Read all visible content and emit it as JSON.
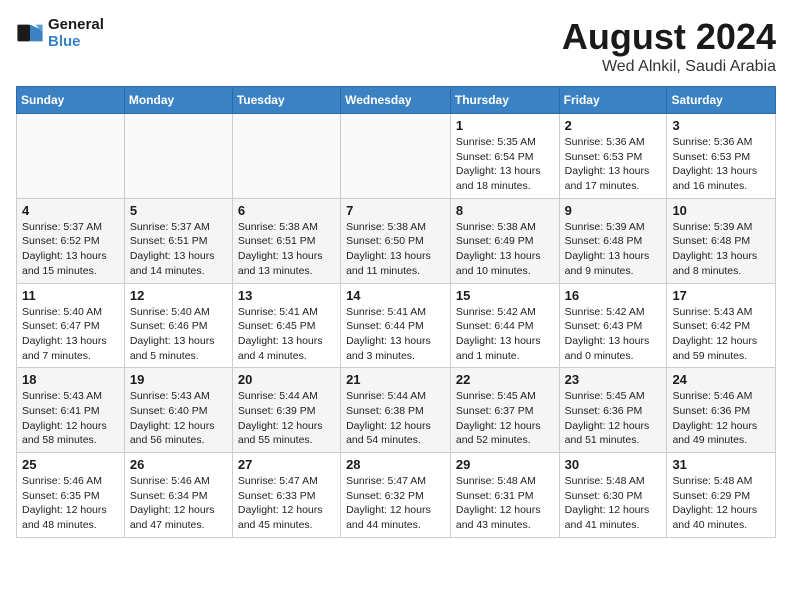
{
  "header": {
    "logo_line1": "General",
    "logo_line2": "Blue",
    "month": "August 2024",
    "location": "Wed Alnkil, Saudi Arabia"
  },
  "weekdays": [
    "Sunday",
    "Monday",
    "Tuesday",
    "Wednesday",
    "Thursday",
    "Friday",
    "Saturday"
  ],
  "weeks": [
    [
      {
        "day": "",
        "info": ""
      },
      {
        "day": "",
        "info": ""
      },
      {
        "day": "",
        "info": ""
      },
      {
        "day": "",
        "info": ""
      },
      {
        "day": "1",
        "info": "Sunrise: 5:35 AM\nSunset: 6:54 PM\nDaylight: 13 hours\nand 18 minutes."
      },
      {
        "day": "2",
        "info": "Sunrise: 5:36 AM\nSunset: 6:53 PM\nDaylight: 13 hours\nand 17 minutes."
      },
      {
        "day": "3",
        "info": "Sunrise: 5:36 AM\nSunset: 6:53 PM\nDaylight: 13 hours\nand 16 minutes."
      }
    ],
    [
      {
        "day": "4",
        "info": "Sunrise: 5:37 AM\nSunset: 6:52 PM\nDaylight: 13 hours\nand 15 minutes."
      },
      {
        "day": "5",
        "info": "Sunrise: 5:37 AM\nSunset: 6:51 PM\nDaylight: 13 hours\nand 14 minutes."
      },
      {
        "day": "6",
        "info": "Sunrise: 5:38 AM\nSunset: 6:51 PM\nDaylight: 13 hours\nand 13 minutes."
      },
      {
        "day": "7",
        "info": "Sunrise: 5:38 AM\nSunset: 6:50 PM\nDaylight: 13 hours\nand 11 minutes."
      },
      {
        "day": "8",
        "info": "Sunrise: 5:38 AM\nSunset: 6:49 PM\nDaylight: 13 hours\nand 10 minutes."
      },
      {
        "day": "9",
        "info": "Sunrise: 5:39 AM\nSunset: 6:48 PM\nDaylight: 13 hours\nand 9 minutes."
      },
      {
        "day": "10",
        "info": "Sunrise: 5:39 AM\nSunset: 6:48 PM\nDaylight: 13 hours\nand 8 minutes."
      }
    ],
    [
      {
        "day": "11",
        "info": "Sunrise: 5:40 AM\nSunset: 6:47 PM\nDaylight: 13 hours\nand 7 minutes."
      },
      {
        "day": "12",
        "info": "Sunrise: 5:40 AM\nSunset: 6:46 PM\nDaylight: 13 hours\nand 5 minutes."
      },
      {
        "day": "13",
        "info": "Sunrise: 5:41 AM\nSunset: 6:45 PM\nDaylight: 13 hours\nand 4 minutes."
      },
      {
        "day": "14",
        "info": "Sunrise: 5:41 AM\nSunset: 6:44 PM\nDaylight: 13 hours\nand 3 minutes."
      },
      {
        "day": "15",
        "info": "Sunrise: 5:42 AM\nSunset: 6:44 PM\nDaylight: 13 hours\nand 1 minute."
      },
      {
        "day": "16",
        "info": "Sunrise: 5:42 AM\nSunset: 6:43 PM\nDaylight: 13 hours\nand 0 minutes."
      },
      {
        "day": "17",
        "info": "Sunrise: 5:43 AM\nSunset: 6:42 PM\nDaylight: 12 hours\nand 59 minutes."
      }
    ],
    [
      {
        "day": "18",
        "info": "Sunrise: 5:43 AM\nSunset: 6:41 PM\nDaylight: 12 hours\nand 58 minutes."
      },
      {
        "day": "19",
        "info": "Sunrise: 5:43 AM\nSunset: 6:40 PM\nDaylight: 12 hours\nand 56 minutes."
      },
      {
        "day": "20",
        "info": "Sunrise: 5:44 AM\nSunset: 6:39 PM\nDaylight: 12 hours\nand 55 minutes."
      },
      {
        "day": "21",
        "info": "Sunrise: 5:44 AM\nSunset: 6:38 PM\nDaylight: 12 hours\nand 54 minutes."
      },
      {
        "day": "22",
        "info": "Sunrise: 5:45 AM\nSunset: 6:37 PM\nDaylight: 12 hours\nand 52 minutes."
      },
      {
        "day": "23",
        "info": "Sunrise: 5:45 AM\nSunset: 6:36 PM\nDaylight: 12 hours\nand 51 minutes."
      },
      {
        "day": "24",
        "info": "Sunrise: 5:46 AM\nSunset: 6:36 PM\nDaylight: 12 hours\nand 49 minutes."
      }
    ],
    [
      {
        "day": "25",
        "info": "Sunrise: 5:46 AM\nSunset: 6:35 PM\nDaylight: 12 hours\nand 48 minutes."
      },
      {
        "day": "26",
        "info": "Sunrise: 5:46 AM\nSunset: 6:34 PM\nDaylight: 12 hours\nand 47 minutes."
      },
      {
        "day": "27",
        "info": "Sunrise: 5:47 AM\nSunset: 6:33 PM\nDaylight: 12 hours\nand 45 minutes."
      },
      {
        "day": "28",
        "info": "Sunrise: 5:47 AM\nSunset: 6:32 PM\nDaylight: 12 hours\nand 44 minutes."
      },
      {
        "day": "29",
        "info": "Sunrise: 5:48 AM\nSunset: 6:31 PM\nDaylight: 12 hours\nand 43 minutes."
      },
      {
        "day": "30",
        "info": "Sunrise: 5:48 AM\nSunset: 6:30 PM\nDaylight: 12 hours\nand 41 minutes."
      },
      {
        "day": "31",
        "info": "Sunrise: 5:48 AM\nSunset: 6:29 PM\nDaylight: 12 hours\nand 40 minutes."
      }
    ]
  ]
}
